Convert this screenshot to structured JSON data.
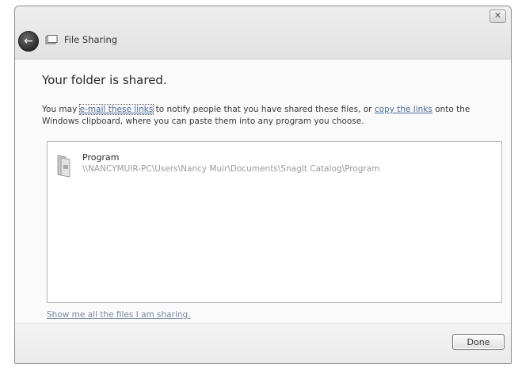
{
  "window": {
    "title": "File Sharing",
    "close_glyph": "✕",
    "back_glyph": "←"
  },
  "main": {
    "heading": "Your folder is shared.",
    "info": {
      "prefix": "You may ",
      "email_link": "e-mail these links",
      "middle": " to notify people that you have shared these files, or ",
      "copy_link": "copy the links",
      "suffix": " onto the Windows clipboard, where you can paste them into any program you choose."
    },
    "shared_items": [
      {
        "name": "Program",
        "path": "\\\\NANCYMUIR-PC\\Users\\Nancy Muir\\Documents\\SnagIt Catalog\\Program",
        "icon": "folder-icon"
      }
    ],
    "show_link": "Show me all the files I am sharing."
  },
  "footer": {
    "done_label": "Done"
  },
  "colors": {
    "link": "#4a6a9a",
    "path_text": "#9a9a9a",
    "back_button": "#3a3a3a"
  }
}
